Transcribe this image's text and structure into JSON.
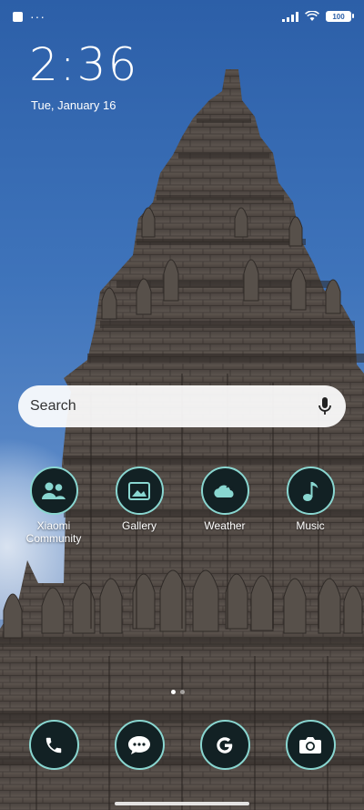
{
  "status_bar": {
    "notification_icons": [
      "square-icon",
      "more-dots-icon"
    ],
    "more_dots": "···",
    "battery_level": "100",
    "system_icons": [
      "signal-icon",
      "wifi-icon",
      "battery-icon"
    ]
  },
  "lockclock": {
    "time": "2:36",
    "date": "Tue, January 16"
  },
  "search": {
    "placeholder": "Search",
    "mic_icon": "microphone-icon"
  },
  "apps": [
    {
      "label": "Xiaomi Community",
      "icon": "community-people-icon"
    },
    {
      "label": "Gallery",
      "icon": "gallery-picture-icon"
    },
    {
      "label": "Weather",
      "icon": "weather-cloud-icon"
    },
    {
      "label": "Music",
      "icon": "music-note-icon"
    }
  ],
  "page_indicator": {
    "pages": 2,
    "current": 1
  },
  "dock": [
    {
      "name": "Phone",
      "icon": "phone-icon"
    },
    {
      "name": "Messaging",
      "icon": "message-bubble-icon"
    },
    {
      "name": "Google",
      "icon": "google-g-icon"
    },
    {
      "name": "Camera",
      "icon": "camera-icon"
    }
  ],
  "colors": {
    "icon_background": "#122124",
    "icon_accent": "#89d6d0",
    "sky": "#2c5fa8"
  }
}
